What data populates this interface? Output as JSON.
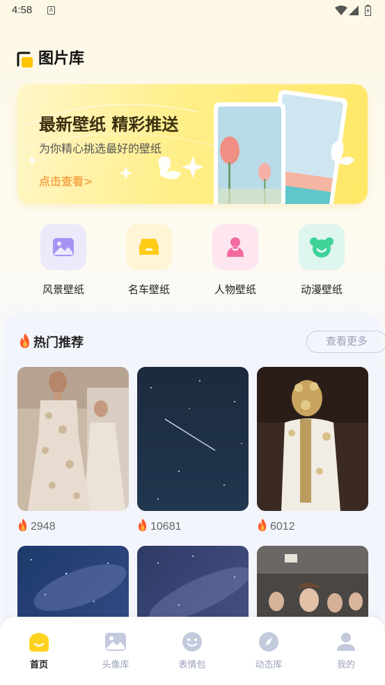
{
  "status": {
    "time": "4:58",
    "a_icon": "A"
  },
  "header": {
    "title": "图片库"
  },
  "banner": {
    "headline": "最新壁纸 精彩推送",
    "subtitle": "为你精心挑选最好的壁纸",
    "cta": "点击查看>"
  },
  "categories": [
    {
      "label": "风景壁纸",
      "icon": "landscape-icon",
      "bg": "#ece9fb",
      "color": "#a692f3"
    },
    {
      "label": "名车壁纸",
      "icon": "car-icon",
      "bg": "#fff4d6",
      "color": "#ffcc1a"
    },
    {
      "label": "人物壁纸",
      "icon": "person-icon",
      "bg": "#fde6ef",
      "color": "#f26aa0"
    },
    {
      "label": "动漫壁纸",
      "icon": "bear-icon",
      "bg": "#dff5ef",
      "color": "#3fd39a"
    }
  ],
  "hot": {
    "title": "热门推荐",
    "more": "查看更多",
    "items": [
      {
        "count": "2948",
        "theme": "fashion-runway"
      },
      {
        "count": "10681",
        "theme": "night-sky"
      },
      {
        "count": "6012",
        "theme": "fashion-back"
      },
      {
        "count": "",
        "theme": "galaxy"
      },
      {
        "count": "",
        "theme": "starry-sky"
      },
      {
        "count": "",
        "theme": "fashion-models"
      }
    ]
  },
  "tabs": [
    {
      "label": "首页",
      "icon": "home-icon",
      "active": true
    },
    {
      "label": "头像库",
      "icon": "image-icon",
      "active": false
    },
    {
      "label": "表情包",
      "icon": "smile-icon",
      "active": false
    },
    {
      "label": "动态库",
      "icon": "compass-icon",
      "active": false
    },
    {
      "label": "我的",
      "icon": "user-icon",
      "active": false
    }
  ],
  "colors": {
    "accent": "#ffd21f",
    "cta": "#f5a84a",
    "tab_inactive": "#9aa3bb"
  }
}
